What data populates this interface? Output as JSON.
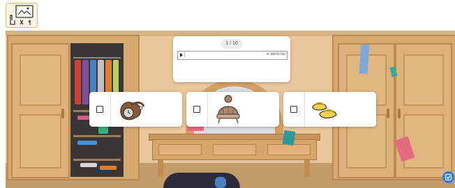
{
  "toolbar": {
    "mode_icon": "drag-and-drop-icon"
  },
  "player": {
    "progress_label": "1 / 10",
    "time_label": "0:00/0:02",
    "play_icon": "play-icon"
  },
  "options": [
    {
      "icon": "watch-icon",
      "checked": false
    },
    {
      "icon": "winter-hat-icon",
      "checked": false
    },
    {
      "icon": "slippers-icon",
      "checked": false
    }
  ],
  "fab": {
    "icon": "check-icon"
  },
  "colors": {
    "accent": "#2f7de1",
    "wall": "#e9c79a",
    "wood": "#d7a96f"
  }
}
